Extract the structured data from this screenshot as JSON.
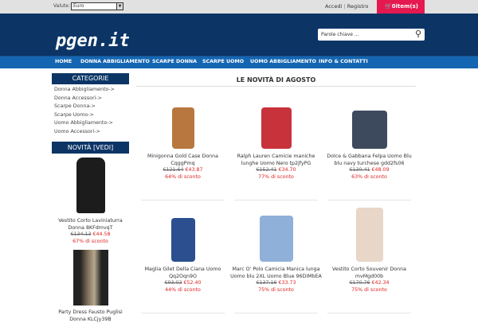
{
  "topbar": {
    "currency_label": "Valute:",
    "currency_value": "Euro",
    "login": "Accedi",
    "separator": "|",
    "register": "Registro",
    "cart": "0item(s)"
  },
  "header": {
    "logo": "pgen.it",
    "search_placeholder": "Parole chiave ..."
  },
  "nav": [
    "HOME",
    "DONNA ABBIGLIAMENTO",
    "SCARPE DONNA",
    "SCARPE UOMO",
    "UOMO ABBIGLIAMENTO",
    "INFO & CONTATTI"
  ],
  "sidebar": {
    "categories_title": "CATEGORIE",
    "categories": [
      "Donna Abbigliamento->",
      "Donna Accessori->",
      "Scarpe Donna->",
      "Scarpe Uomo->",
      "Uomo Abbigliamento->",
      "Uomo Accessori->"
    ],
    "new_title": "NOVITÀ  [VEDI]",
    "new_items": [
      {
        "name": "Vestito Corto Laviniaturra Donna 8KFdmvqT",
        "old": "€134.13",
        "new": "€44.58",
        "discount": "67% di sconto",
        "color": "#1c1c1c"
      },
      {
        "name": "Party Dress Fausto Puglisi Donna KLCjy39B",
        "color": "#6a5a48"
      }
    ]
  },
  "main": {
    "title": "LE NOVITÀ DI AGOSTO",
    "products": [
      {
        "name": "Minigonna Gold Case Donna CqggPmq",
        "old": "€121.64",
        "new": "€43.87",
        "discount": "64% di sconto",
        "color": "#b8773f"
      },
      {
        "name": "Ralph Lauren Camicie maniche lunghe Uomo Nero tp2jfyPG",
        "old": "€152.41",
        "new": "€34.70",
        "discount": "77% di sconto",
        "color": "#c8323a"
      },
      {
        "name": "Dolce & Gabbana Felpa Uomo Blu blu navy turchese gdd2fs06",
        "old": "€130.41",
        "new": "€48.09",
        "discount": "63% di sconto",
        "color": "#3d4a5e"
      },
      {
        "name": "Maglia Gilet Della Ciana Uomo Qq2Oqn9O",
        "old": "€93.03",
        "new": "€52.40",
        "discount": "44% di sconto",
        "color": "#2b4f8f"
      },
      {
        "name": "Marc O' Polo Camicia Manica lunga Uomo blu 2XL Uomo Blue 96DiMbEA",
        "old": "€137.16",
        "new": "€33.73",
        "discount": "75% di sconto",
        "color": "#8fb0d8"
      },
      {
        "name": "Vestito Corto Souvenir Donna mvMgd00b",
        "old": "€170.76",
        "new": "€42.34",
        "discount": "75% di sconto",
        "color": "#e8d6c8"
      }
    ]
  }
}
